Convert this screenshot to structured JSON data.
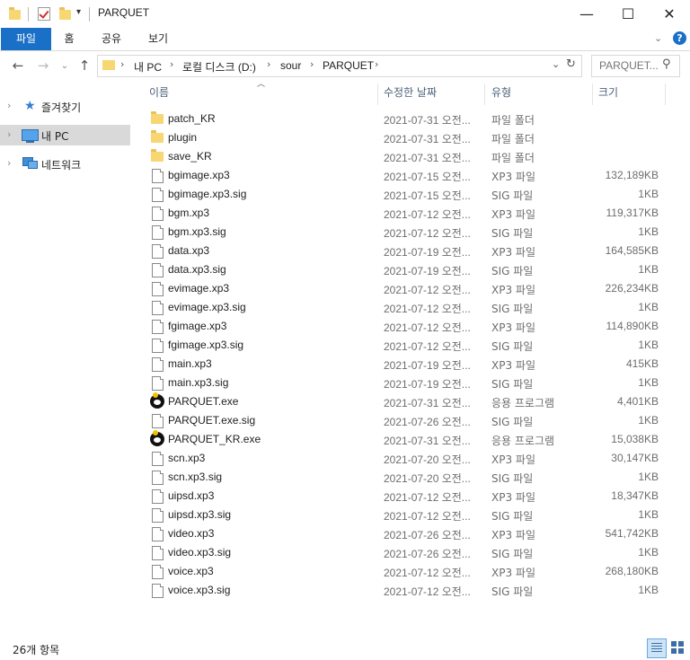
{
  "window": {
    "title": "PARQUET",
    "controls": {
      "minimize": "—",
      "maximize": "☐",
      "close": "✕"
    }
  },
  "ribbon": {
    "tabs": [
      "파일",
      "홈",
      "공유",
      "보기"
    ],
    "help_label": "?"
  },
  "address": {
    "breadcrumbs": [
      "내 PC",
      "로컬 디스크 (D:)",
      "sour",
      "PARQUET"
    ],
    "search_placeholder": "PARQUET..."
  },
  "nav": {
    "items": [
      {
        "label": "즐겨찾기",
        "icon": "star-icon"
      },
      {
        "label": "내 PC",
        "icon": "computer-icon",
        "selected": true
      },
      {
        "label": "네트워크",
        "icon": "network-icon"
      }
    ]
  },
  "columns": {
    "name": "이름",
    "date": "수정한 날짜",
    "type": "유형",
    "size": "크기"
  },
  "files": [
    {
      "name": "patch_KR",
      "date": "2021-07-31 오전...",
      "type": "파일 폴더",
      "size": "",
      "icon": "folder"
    },
    {
      "name": "plugin",
      "date": "2021-07-31 오전...",
      "type": "파일 폴더",
      "size": "",
      "icon": "folder"
    },
    {
      "name": "save_KR",
      "date": "2021-07-31 오전...",
      "type": "파일 폴더",
      "size": "",
      "icon": "folder"
    },
    {
      "name": "bgimage.xp3",
      "date": "2021-07-15 오전...",
      "type": "XP3 파일",
      "size": "132,189KB",
      "icon": "file"
    },
    {
      "name": "bgimage.xp3.sig",
      "date": "2021-07-15 오전...",
      "type": "SIG 파일",
      "size": "1KB",
      "icon": "file"
    },
    {
      "name": "bgm.xp3",
      "date": "2021-07-12 오전...",
      "type": "XP3 파일",
      "size": "119,317KB",
      "icon": "file"
    },
    {
      "name": "bgm.xp3.sig",
      "date": "2021-07-12 오전...",
      "type": "SIG 파일",
      "size": "1KB",
      "icon": "file"
    },
    {
      "name": "data.xp3",
      "date": "2021-07-19 오전...",
      "type": "XP3 파일",
      "size": "164,585KB",
      "icon": "file"
    },
    {
      "name": "data.xp3.sig",
      "date": "2021-07-19 오전...",
      "type": "SIG 파일",
      "size": "1KB",
      "icon": "file"
    },
    {
      "name": "evimage.xp3",
      "date": "2021-07-12 오전...",
      "type": "XP3 파일",
      "size": "226,234KB",
      "icon": "file"
    },
    {
      "name": "evimage.xp3.sig",
      "date": "2021-07-12 오전...",
      "type": "SIG 파일",
      "size": "1KB",
      "icon": "file"
    },
    {
      "name": "fgimage.xp3",
      "date": "2021-07-12 오전...",
      "type": "XP3 파일",
      "size": "114,890KB",
      "icon": "file"
    },
    {
      "name": "fgimage.xp3.sig",
      "date": "2021-07-12 오전...",
      "type": "SIG 파일",
      "size": "1KB",
      "icon": "file"
    },
    {
      "name": "main.xp3",
      "date": "2021-07-19 오전...",
      "type": "XP3 파일",
      "size": "415KB",
      "icon": "file"
    },
    {
      "name": "main.xp3.sig",
      "date": "2021-07-19 오전...",
      "type": "SIG 파일",
      "size": "1KB",
      "icon": "file"
    },
    {
      "name": "PARQUET.exe",
      "date": "2021-07-31 오전...",
      "type": "응용 프로그램",
      "size": "4,401KB",
      "icon": "exe"
    },
    {
      "name": "PARQUET.exe.sig",
      "date": "2021-07-26 오전...",
      "type": "SIG 파일",
      "size": "1KB",
      "icon": "file"
    },
    {
      "name": "PARQUET_KR.exe",
      "date": "2021-07-31 오전...",
      "type": "응용 프로그램",
      "size": "15,038KB",
      "icon": "exe"
    },
    {
      "name": "scn.xp3",
      "date": "2021-07-20 오전...",
      "type": "XP3 파일",
      "size": "30,147KB",
      "icon": "file"
    },
    {
      "name": "scn.xp3.sig",
      "date": "2021-07-20 오전...",
      "type": "SIG 파일",
      "size": "1KB",
      "icon": "file"
    },
    {
      "name": "uipsd.xp3",
      "date": "2021-07-12 오전...",
      "type": "XP3 파일",
      "size": "18,347KB",
      "icon": "file"
    },
    {
      "name": "uipsd.xp3.sig",
      "date": "2021-07-12 오전...",
      "type": "SIG 파일",
      "size": "1KB",
      "icon": "file"
    },
    {
      "name": "video.xp3",
      "date": "2021-07-26 오전...",
      "type": "XP3 파일",
      "size": "541,742KB",
      "icon": "file"
    },
    {
      "name": "video.xp3.sig",
      "date": "2021-07-26 오전...",
      "type": "SIG 파일",
      "size": "1KB",
      "icon": "file"
    },
    {
      "name": "voice.xp3",
      "date": "2021-07-12 오전...",
      "type": "XP3 파일",
      "size": "268,180KB",
      "icon": "file"
    },
    {
      "name": "voice.xp3.sig",
      "date": "2021-07-12 오전...",
      "type": "SIG 파일",
      "size": "1KB",
      "icon": "file"
    }
  ],
  "status": {
    "item_count": "26개 항목"
  },
  "colors": {
    "accent": "#1a6fc7",
    "folder": "#f8d672",
    "selected_nav": "#d9d9d9"
  }
}
